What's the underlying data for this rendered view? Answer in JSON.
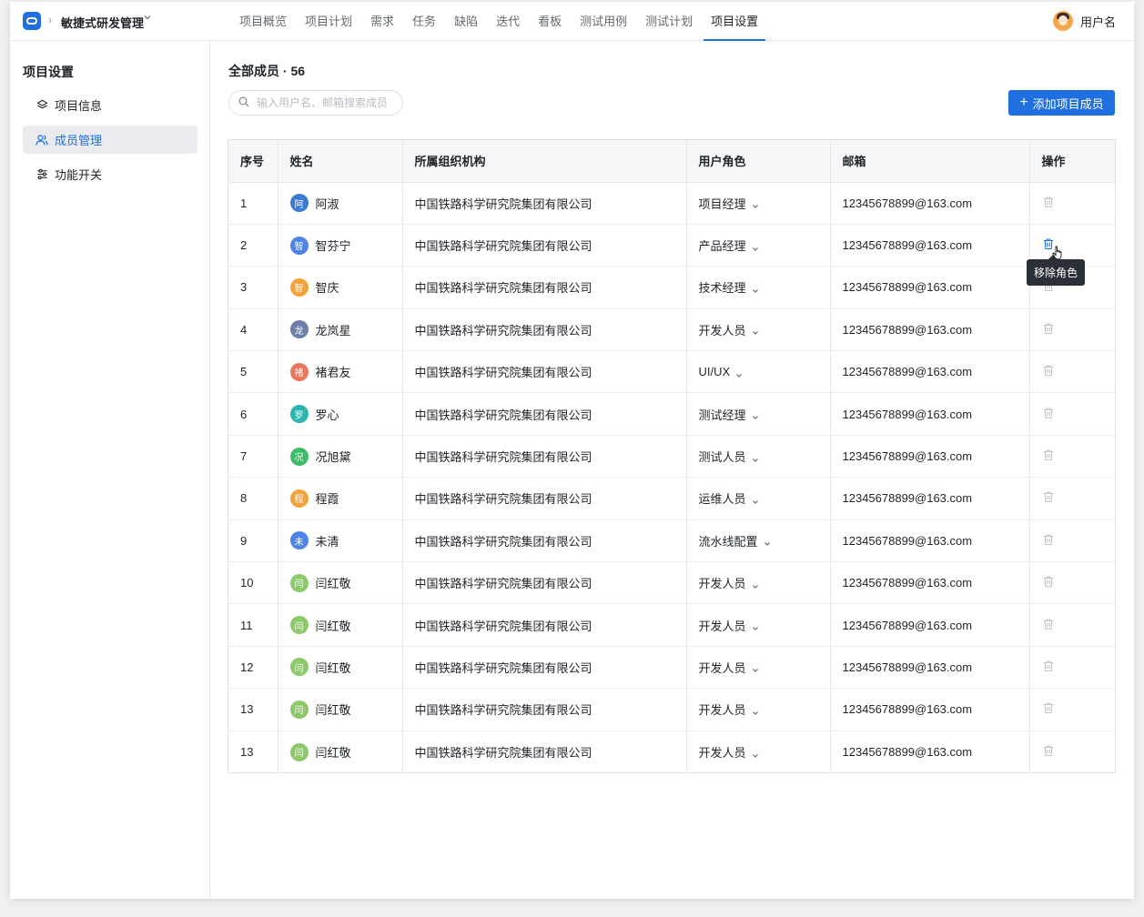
{
  "header": {
    "project_name": "敏捷式研发管理",
    "nav": [
      {
        "label": "项目概览",
        "active": false
      },
      {
        "label": "项目计划",
        "active": false
      },
      {
        "label": "需求",
        "active": false
      },
      {
        "label": "任务",
        "active": false
      },
      {
        "label": "缺陷",
        "active": false
      },
      {
        "label": "迭代",
        "active": false
      },
      {
        "label": "看板",
        "active": false
      },
      {
        "label": "测试用例",
        "active": false
      },
      {
        "label": "测试计划",
        "active": false
      },
      {
        "label": "项目设置",
        "active": true
      }
    ],
    "username": "用户名"
  },
  "sidebar": {
    "title": "项目设置",
    "items": [
      {
        "label": "项目信息",
        "icon": "layers-icon",
        "active": false
      },
      {
        "label": "成员管理",
        "icon": "users-icon",
        "active": true
      },
      {
        "label": "功能开关",
        "icon": "sliders-icon",
        "active": false
      }
    ]
  },
  "main": {
    "title": "全部成员 · 56",
    "search_placeholder": "输入用户名、邮箱搜索成员",
    "add_button": "添加项目成员",
    "tooltip": "移除角色"
  },
  "table": {
    "headers": [
      "序号",
      "姓名",
      "所属组织机构",
      "用户角色",
      "邮箱",
      "操作"
    ],
    "rows": [
      {
        "idx": "1",
        "avatar": "阿",
        "avatar_color": "#3a7bd5",
        "name": "阿淑",
        "org": "中国铁路科学研究院集团有限公司",
        "role": "项目经理",
        "email": "12345678899@163.com",
        "active": false
      },
      {
        "idx": "2",
        "avatar": "智",
        "avatar_color": "#4e84e8",
        "name": "智芬宁",
        "org": "中国铁路科学研究院集团有限公司",
        "role": "产品经理",
        "email": "12345678899@163.com",
        "active": true
      },
      {
        "idx": "3",
        "avatar": "智",
        "avatar_color": "#f2a33a",
        "name": "智庆",
        "org": "中国铁路科学研究院集团有限公司",
        "role": "技术经理",
        "email": "12345678899@163.com",
        "active": false
      },
      {
        "idx": "4",
        "avatar": "龙",
        "avatar_color": "#6b7fa8",
        "name": "龙岚星",
        "org": "中国铁路科学研究院集团有限公司",
        "role": "开发人员",
        "email": "12345678899@163.com",
        "active": false
      },
      {
        "idx": "5",
        "avatar": "褚",
        "avatar_color": "#e8765a",
        "name": "褚君友",
        "org": "中国铁路科学研究院集团有限公司",
        "role": "UI/UX",
        "email": "12345678899@163.com",
        "active": false
      },
      {
        "idx": "6",
        "avatar": "罗",
        "avatar_color": "#2cb5b0",
        "name": "罗心",
        "org": "中国铁路科学研究院集团有限公司",
        "role": "测试经理",
        "email": "12345678899@163.com",
        "active": false
      },
      {
        "idx": "7",
        "avatar": "况",
        "avatar_color": "#3dbb6a",
        "name": "况旭黛",
        "org": "中国铁路科学研究院集团有限公司",
        "role": "测试人员",
        "email": "12345678899@163.com",
        "active": false
      },
      {
        "idx": "8",
        "avatar": "程",
        "avatar_color": "#f2a33a",
        "name": "程霞",
        "org": "中国铁路科学研究院集团有限公司",
        "role": "运维人员",
        "email": "12345678899@163.com",
        "active": false
      },
      {
        "idx": "9",
        "avatar": "未",
        "avatar_color": "#4e84e8",
        "name": "未清",
        "org": "中国铁路科学研究院集团有限公司",
        "role": "流水线配置",
        "email": "12345678899@163.com",
        "active": false
      },
      {
        "idx": "10",
        "avatar": "闫",
        "avatar_color": "#8bc96a",
        "name": "闫红敬",
        "org": "中国铁路科学研究院集团有限公司",
        "role": "开发人员",
        "email": "12345678899@163.com",
        "active": false
      },
      {
        "idx": "11",
        "avatar": "闫",
        "avatar_color": "#8bc96a",
        "name": "闫红敬",
        "org": "中国铁路科学研究院集团有限公司",
        "role": "开发人员",
        "email": "12345678899@163.com",
        "active": false
      },
      {
        "idx": "12",
        "avatar": "闫",
        "avatar_color": "#8bc96a",
        "name": "闫红敬",
        "org": "中国铁路科学研究院集团有限公司",
        "role": "开发人员",
        "email": "12345678899@163.com",
        "active": false
      },
      {
        "idx": "13",
        "avatar": "闫",
        "avatar_color": "#8bc96a",
        "name": "闫红敬",
        "org": "中国铁路科学研究院集团有限公司",
        "role": "开发人员",
        "email": "12345678899@163.com",
        "active": false
      },
      {
        "idx": "13",
        "avatar": "闫",
        "avatar_color": "#8bc96a",
        "name": "闫红敬",
        "org": "中国铁路科学研究院集团有限公司",
        "role": "开发人员",
        "email": "12345678899@163.com",
        "active": false
      }
    ]
  },
  "colors": {
    "accent": "#1f6fe0",
    "trash_default": "#c0c4cc",
    "trash_active": "#1f6fe0"
  }
}
